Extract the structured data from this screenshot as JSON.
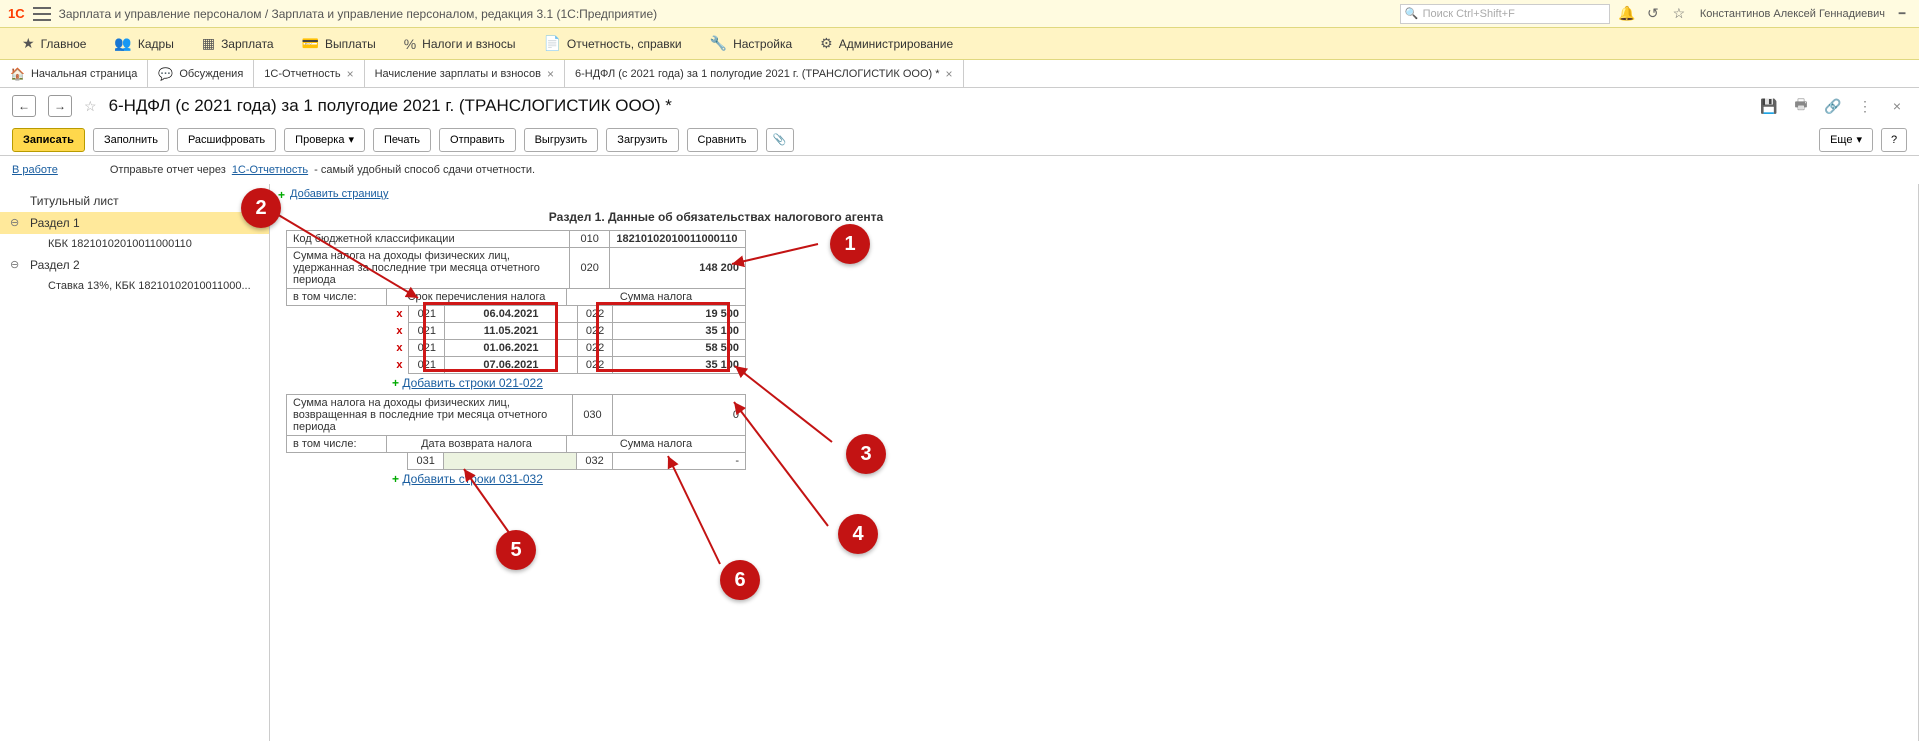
{
  "top": {
    "app_title": "Зарплата и управление персоналом / Зарплата и управление персоналом, редакция 3.1  (1С:Предприятие)",
    "search_placeholder": "Поиск Ctrl+Shift+F",
    "user": "Константинов Алексей Геннадиевич"
  },
  "menu": {
    "items": [
      {
        "label": "Главное"
      },
      {
        "label": "Кадры"
      },
      {
        "label": "Зарплата"
      },
      {
        "label": "Выплаты"
      },
      {
        "label": "Налоги и взносы"
      },
      {
        "label": "Отчетность, справки"
      },
      {
        "label": "Настройка"
      },
      {
        "label": "Администрирование"
      }
    ]
  },
  "tabs": {
    "items": [
      {
        "label": "Начальная страница"
      },
      {
        "label": "Обсуждения"
      },
      {
        "label": "1С-Отчетность"
      },
      {
        "label": "Начисление зарплаты и взносов"
      },
      {
        "label": "6-НДФЛ (с 2021 года) за 1 полугодие 2021 г. (ТРАНСЛОГИСТИК ООО) *"
      }
    ]
  },
  "page": {
    "title": "6-НДФЛ (с 2021 года) за 1 полугодие 2021 г. (ТРАНСЛОГИСТИК ООО) *"
  },
  "toolbar": {
    "save": "Записать",
    "fill": "Заполнить",
    "decode": "Расшифровать",
    "check": "Проверка",
    "print": "Печать",
    "send": "Отправить",
    "upload": "Выгрузить",
    "download": "Загрузить",
    "compare": "Сравнить",
    "more": "Еще"
  },
  "status": {
    "state": "В работе",
    "prefix": "Отправьте отчет через ",
    "link": "1С-Отчетность",
    "suffix": " - самый удобный способ сдачи отчетности."
  },
  "nav": {
    "title": "Титульный лист",
    "sec1": "Раздел 1",
    "kbk": "КБК 18210102010011000110",
    "sec2": "Раздел 2",
    "rate": "Ставка 13%, КБК 18210102010011000..."
  },
  "form": {
    "add_page": "Добавить страницу",
    "section_title": "Раздел 1. Данные об обязательствах налогового агента",
    "r010_label": "Код бюджетной классификации",
    "r010_code": "010",
    "r010_val": "18210102010011000110",
    "r020_label": "Сумма налога на доходы физических лиц, удержанная за последние три месяца отчетного периода",
    "r020_code": "020",
    "r020_val": "148 200",
    "incl": "в том числе:",
    "col_date": "Срок перечисления налога",
    "col_sum": "Сумма налога",
    "rows021": [
      {
        "c021": "021",
        "date": "06.04.2021",
        "c022": "022",
        "sum": "19 500"
      },
      {
        "c021": "021",
        "date": "11.05.2021",
        "c022": "022",
        "sum": "35 100"
      },
      {
        "c021": "021",
        "date": "01.06.2021",
        "c022": "022",
        "sum": "58 500"
      },
      {
        "c021": "021",
        "date": "07.06.2021",
        "c022": "022",
        "sum": "35 100"
      }
    ],
    "add021": "Добавить строки 021-022",
    "r030_label": "Сумма налога на доходы физических лиц, возвращенная в последние три месяца отчетного периода",
    "r030_code": "030",
    "r030_val": "0",
    "col_date2": "Дата возврата налога",
    "col_sum2": "Сумма налога",
    "r031": "031",
    "r032": "032",
    "r032_val": "-",
    "add031": "Добавить строки 031-032"
  },
  "callouts": {
    "c1": "1",
    "c2": "2",
    "c3": "3",
    "c4": "4",
    "c5": "5",
    "c6": "6"
  }
}
